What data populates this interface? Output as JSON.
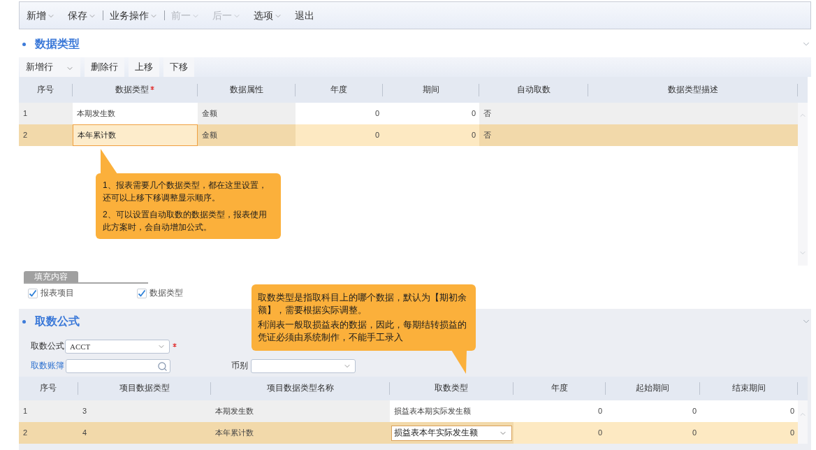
{
  "toolbar": [
    {
      "kind": "menu",
      "label": "新增",
      "dropdown": true,
      "disabled": false
    },
    {
      "kind": "menu",
      "label": "保存",
      "dropdown": true,
      "disabled": false
    },
    {
      "kind": "separator"
    },
    {
      "kind": "menu",
      "label": "业务操作",
      "dropdown": true,
      "disabled": false
    },
    {
      "kind": "separator"
    },
    {
      "kind": "menu",
      "label": "前一",
      "dropdown": true,
      "disabled": true
    },
    {
      "kind": "menu",
      "label": "后一",
      "dropdown": true,
      "disabled": true
    },
    {
      "kind": "menu",
      "label": "选项",
      "dropdown": true,
      "disabled": false
    },
    {
      "kind": "menu",
      "label": "退出",
      "dropdown": false,
      "disabled": false
    }
  ],
  "data_types": {
    "title": "数据类型",
    "row_toolbar": [
      {
        "label": "新增行",
        "dropdown": true
      },
      {
        "label": "删除行",
        "dropdown": false
      },
      {
        "label": "上移",
        "dropdown": false
      },
      {
        "label": "下移",
        "dropdown": false
      }
    ],
    "table": {
      "columns": [
        {
          "label": "序号",
          "kind": "text",
          "editable": false,
          "required": false
        },
        {
          "label": "数据类型",
          "kind": "text",
          "editable": true,
          "required": true
        },
        {
          "label": "数据属性",
          "kind": "text",
          "editable": false,
          "required": false
        },
        {
          "label": "年度",
          "kind": "number",
          "editable": true,
          "required": false
        },
        {
          "label": "期间",
          "kind": "number",
          "editable": true,
          "required": false
        },
        {
          "label": "自动取数",
          "kind": "text",
          "editable": false,
          "required": false
        },
        {
          "label": "数据类型描述",
          "kind": "text",
          "editable": false,
          "required": false
        }
      ],
      "rows": [
        {
          "selected": false,
          "cells": [
            {
              "text": "1",
              "focused": false
            },
            {
              "text": "本期发生数",
              "focused": false
            },
            {
              "text": "金额",
              "focused": false
            },
            {
              "text": "0",
              "focused": false
            },
            {
              "text": "0",
              "focused": false
            },
            {
              "text": "否",
              "focused": false
            },
            {
              "focused": false
            }
          ]
        },
        {
          "selected": true,
          "cells": [
            {
              "text": "2",
              "focused": false
            },
            {
              "text": "本年累计数",
              "focused": true
            },
            {
              "text": "金额",
              "focused": false
            },
            {
              "text": "0",
              "focused": false
            },
            {
              "text": "0",
              "focused": false
            },
            {
              "text": "否",
              "focused": false
            },
            {
              "focused": false
            }
          ]
        }
      ]
    },
    "note": {
      "paragraphs": [
        "1、报表需要几个数据类型，都在这里设置，还可以上移下移调整显示顺序。",
        "2、可以设置自动取数的数据类型，报表使用此方案时，会自动增加公式。"
      ]
    }
  },
  "fill_content": {
    "tab": "填充内容",
    "options": [
      {
        "label": "报表项目",
        "checked": true
      },
      {
        "label": "数据类型",
        "checked": true
      }
    ]
  },
  "fetch_formula": {
    "note": {
      "paragraphs": [
        "取数类型是指取科目上的哪个数据，默认为【期初余额】，需要根据实际调整。",
        "利润表一般取损益表的数据，因此，每期结转损益的凭证必须由系统制作，不能手工录入"
      ]
    },
    "title": "取数公式",
    "formula": {
      "label": "取数公式",
      "value": "ACCT",
      "required": true
    },
    "ledger": {
      "label": "取数账簿"
    },
    "currency": {
      "label": "币别"
    },
    "table": {
      "columns": [
        {
          "label": "序号",
          "kind": "text",
          "editable": false,
          "required": false
        },
        {
          "label": "项目数据类型",
          "kind": "text",
          "editable": false,
          "required": false
        },
        {
          "label": "项目数据类型名称",
          "kind": "text",
          "editable": false,
          "required": false
        },
        {
          "label": "取数类型",
          "kind": "select",
          "editable": true,
          "required": false
        },
        {
          "label": "年度",
          "kind": "number",
          "editable": true,
          "required": false
        },
        {
          "label": "起始期间",
          "kind": "number",
          "editable": true,
          "required": false
        },
        {
          "label": "结束期间",
          "kind": "number",
          "editable": true,
          "required": false
        }
      ],
      "rows": [
        {
          "selected": false,
          "cells": [
            {
              "text": "1",
              "focused": false
            },
            {
              "text": "3",
              "focused": false
            },
            {
              "text": "本期发生数",
              "focused": false
            },
            {
              "text": "损益表本期实际发生额",
              "focused": false
            },
            {
              "text": "0",
              "focused": false
            },
            {
              "text": "0",
              "focused": false
            },
            {
              "text": "0",
              "focused": false
            }
          ]
        },
        {
          "selected": true,
          "cells": [
            {
              "text": "2",
              "focused": false
            },
            {
              "text": "4",
              "focused": false
            },
            {
              "text": "本年累计数",
              "focused": false
            },
            {
              "text": "损益表本年实际发生额",
              "focused": true
            },
            {
              "text": "0",
              "focused": false
            },
            {
              "text": "0",
              "focused": false
            },
            {
              "text": "0",
              "focused": false
            }
          ]
        }
      ]
    }
  }
}
